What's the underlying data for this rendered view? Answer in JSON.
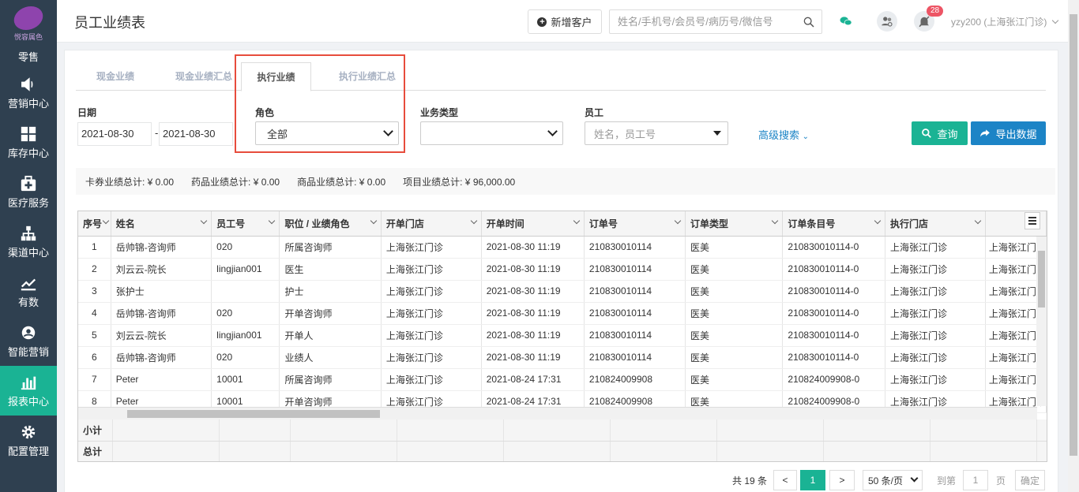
{
  "brand": {
    "logo_text": "悦容属色"
  },
  "sidebar": {
    "items": [
      {
        "label": "零售"
      },
      {
        "label": "营销中心"
      },
      {
        "label": "库存中心"
      },
      {
        "label": "医疗服务"
      },
      {
        "label": "渠道中心"
      },
      {
        "label": "有数"
      },
      {
        "label": "智能营销"
      },
      {
        "label": "报表中心",
        "active": true
      },
      {
        "label": "配置管理"
      }
    ]
  },
  "header": {
    "title": "员工业绩表",
    "new_customer": "新增客户",
    "search_placeholder": "姓名/手机号/会员号/病历号/微信号",
    "notification_count": "28",
    "user": "yzy200 (上海张江门诊)"
  },
  "tabs": [
    "现金业绩",
    "现金业绩汇总",
    "执行业绩",
    "执行业绩汇总"
  ],
  "filters": {
    "date_label": "日期",
    "date_from": "2021-08-30",
    "date_sep": "-",
    "date_to": "2021-08-30",
    "role_label": "角色",
    "role_value": "全部",
    "biz_type_label": "业务类型",
    "biz_type_value": "",
    "employee_label": "员工",
    "employee_placeholder": "姓名，员工号",
    "advanced": "高级搜索",
    "query": "查询",
    "export": "导出数据"
  },
  "summary": [
    "卡券业绩总计: ¥ 0.00",
    "药品业绩总计: ¥ 0.00",
    "商品业绩总计: ¥ 0.00",
    "项目业绩总计: ¥ 96,000.00"
  ],
  "table": {
    "columns": [
      "序号",
      "姓名",
      "员工号",
      "职位 / 业绩角色",
      "开单门店",
      "开单时间",
      "订单号",
      "订单类型",
      "订单条目号",
      "执行门店"
    ],
    "rows": [
      [
        "1",
        "岳帅锦-咨询师",
        "020",
        "所属咨询师",
        "上海张江门诊",
        "2021-08-30 11:19",
        "210830010114",
        "医美",
        "210830010114-0",
        "上海张江门诊"
      ],
      [
        "2",
        "刘云云-院长",
        "lingjian001",
        "医生",
        "上海张江门诊",
        "2021-08-30 11:19",
        "210830010114",
        "医美",
        "210830010114-0",
        "上海张江门诊"
      ],
      [
        "3",
        "张护士",
        "",
        "护士",
        "上海张江门诊",
        "2021-08-30 11:19",
        "210830010114",
        "医美",
        "210830010114-0",
        "上海张江门诊"
      ],
      [
        "4",
        "岳帅锦-咨询师",
        "020",
        "开单咨询师",
        "上海张江门诊",
        "2021-08-30 11:19",
        "210830010114",
        "医美",
        "210830010114-0",
        "上海张江门诊"
      ],
      [
        "5",
        "刘云云-院长",
        "lingjian001",
        "开单人",
        "上海张江门诊",
        "2021-08-30 11:19",
        "210830010114",
        "医美",
        "210830010114-0",
        "上海张江门诊"
      ],
      [
        "6",
        "岳帅锦-咨询师",
        "020",
        "业绩人",
        "上海张江门诊",
        "2021-08-30 11:19",
        "210830010114",
        "医美",
        "210830010114-0",
        "上海张江门诊"
      ],
      [
        "7",
        "Peter",
        "10001",
        "所属咨询师",
        "上海张江门诊",
        "2021-08-24 17:31",
        "210824009908",
        "医美",
        "210824009908-0",
        "上海张江门诊"
      ],
      [
        "8",
        "Peter",
        "10001",
        "开单咨询师",
        "上海张江门诊",
        "2021-08-24 17:31",
        "210824009908",
        "医美",
        "210824009908-0",
        "上海张江门诊"
      ]
    ],
    "subtotal_label": "小计",
    "total_label": "总计"
  },
  "pagination": {
    "total": "共 19 条",
    "prev": "<",
    "current": "1",
    "next": ">",
    "page_size": "50 条/页",
    "goto_label": "到第",
    "goto_value": "1",
    "page_unit": "页",
    "confirm": "确定"
  }
}
